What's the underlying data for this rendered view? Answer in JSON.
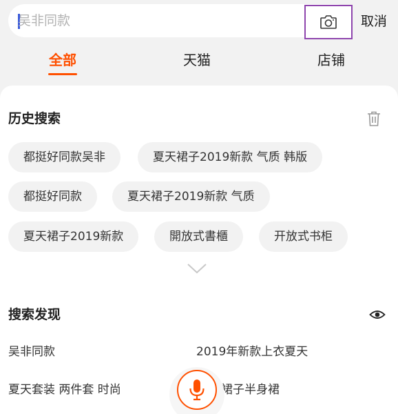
{
  "search": {
    "placeholder": "吴非同款",
    "cancel_label": "取消"
  },
  "tabs": [
    {
      "label": "全部",
      "active": true
    },
    {
      "label": "天猫",
      "active": false
    },
    {
      "label": "店铺",
      "active": false
    }
  ],
  "history": {
    "title": "历史搜索",
    "items": [
      "都挺好同款吴非",
      "夏天裙子2019新款 气质 韩版",
      "都挺好同款",
      "夏天裙子2019新款 气质",
      "夏天裙子2019新款",
      "開放式書櫃",
      "开放式书柜"
    ]
  },
  "discover": {
    "title": "搜索发现",
    "items": [
      "吴非同款",
      "2019年新款上衣夏天",
      "夏天套装 两件套 时尚",
      "裙子半身裙"
    ]
  },
  "icons": {
    "camera": "camera-icon",
    "trash": "trash-icon",
    "expand": "chevron-down-icon",
    "eye": "eye-icon",
    "mic": "microphone-icon"
  },
  "colors": {
    "accent": "#ff5000",
    "highlight_border": "#8e44ad",
    "caret": "#3b5bdb"
  }
}
